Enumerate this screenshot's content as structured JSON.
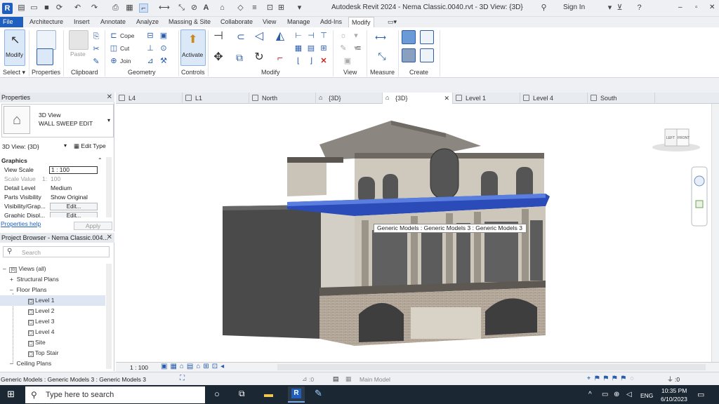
{
  "window": {
    "app_icon": "R",
    "title": "Autodesk Revit 2024 - Nema Classic.0040.rvt - 3D View: {3D}",
    "sign_in": "Sign In",
    "minimize": "–",
    "maximize": "▫",
    "close": "✕"
  },
  "ribbon_tabs": [
    "File",
    "Architecture",
    "Insert",
    "Annotate",
    "Analyze",
    "Massing & Site",
    "Collaborate",
    "View",
    "Manage",
    "Add-Ins",
    "Modify"
  ],
  "ribbon": {
    "modify_label": "Modify",
    "paste_label": "Paste",
    "cope_label": "Cope",
    "cut_label": "Cut",
    "join_label": "Join",
    "activate_label": "Activate",
    "panels": {
      "select": "Select",
      "properties": "Properties",
      "clipboard": "Clipboard",
      "geometry": "Geometry",
      "controls": "Controls",
      "modify": "Modify",
      "view": "View",
      "measure": "Measure",
      "create": "Create"
    }
  },
  "properties_panel": {
    "header": "Properties",
    "type_line1": "3D View",
    "type_line2": "WALL SWEEP EDIT",
    "selector_value": "3D View: {3D}",
    "edit_type": "Edit Type",
    "section": "Graphics",
    "rows": [
      {
        "label": "View Scale",
        "value": "1 : 100"
      },
      {
        "label": "Scale Value",
        "value": "1:",
        "value2": "100"
      },
      {
        "label": "Detail Level",
        "value": "Medium"
      },
      {
        "label": "Parts Visibility",
        "value": "Show Original"
      },
      {
        "label": "Visibility/Grap...",
        "value": "Edit..."
      },
      {
        "label": "Graphic Displ...",
        "value": "Edit..."
      }
    ],
    "help_link": "Properties help",
    "apply": "Apply"
  },
  "project_browser": {
    "header": "Project Browser - Nema Classic.004...",
    "search_placeholder": "Search",
    "items": [
      {
        "label": "Views (all)",
        "expander": "–"
      },
      {
        "label": "Structural Plans",
        "expander": "+"
      },
      {
        "label": "Floor Plans",
        "expander": "–"
      },
      {
        "label": "Level 1"
      },
      {
        "label": "Level 2"
      },
      {
        "label": "Level 3"
      },
      {
        "label": "Level 4"
      },
      {
        "label": "Site"
      },
      {
        "label": "Top Stair"
      },
      {
        "label": "Ceiling Plans",
        "expander": "–"
      }
    ]
  },
  "view_tabs": [
    "L4",
    "L1",
    "North",
    "{3D}",
    "{3D}",
    "Level 1",
    "Level 4",
    "South"
  ],
  "viewcube": {
    "left": "LEFT",
    "front": "FRONT"
  },
  "tooltip": "Generic Models : Generic Models 3 : Generic Models 3",
  "view_control": {
    "scale": "1 : 100"
  },
  "status": {
    "text": "Generic Models : Generic Models 3 : Generic Models 3",
    "workset_value": ":0",
    "model": "Main Model",
    "filter_count": ":0"
  },
  "taskbar": {
    "search": "Type here to search",
    "lang": "ENG",
    "time": "10:35 PM",
    "date": "6/10/2023"
  },
  "colors": {
    "revit_blue": "#1f5fbf",
    "selection_blue": "#1c3fa8",
    "taskbar": "#1c2734"
  }
}
